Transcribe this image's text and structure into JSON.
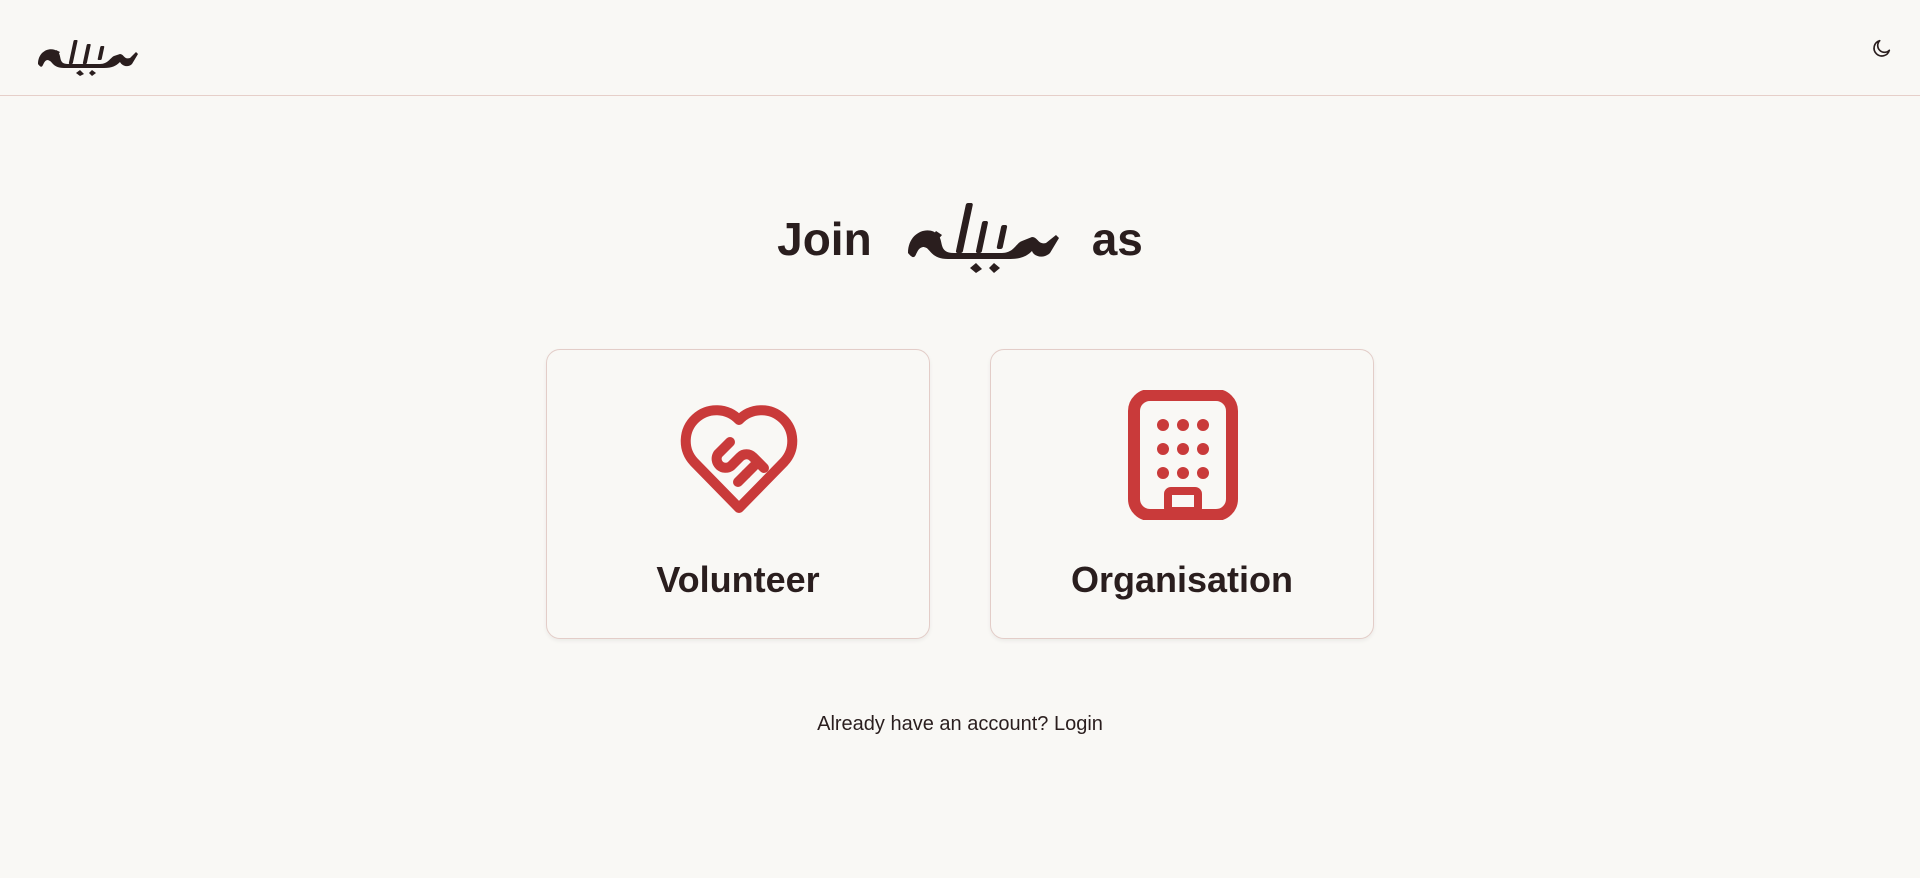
{
  "header": {
    "logo_alt": "سبيل",
    "theme_toggle_icon": "moon-icon"
  },
  "headline": {
    "prefix": "Join",
    "brand": "سبيل",
    "suffix": "as"
  },
  "roles": [
    {
      "label": "Volunteer",
      "icon": "heart-handshake-icon"
    },
    {
      "label": "Organisation",
      "icon": "building-icon"
    }
  ],
  "footer": {
    "prompt": "Already have an account?",
    "login_label": "Login"
  },
  "colors": {
    "accent": "#c93a3a",
    "text": "#2a1e1e",
    "background": "#f9f8f5",
    "border": "#e3cdc8"
  }
}
